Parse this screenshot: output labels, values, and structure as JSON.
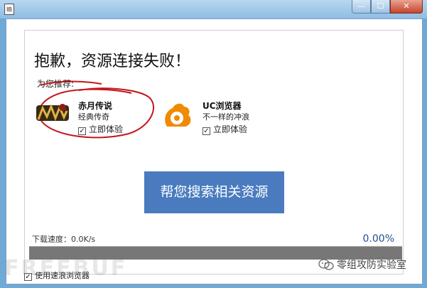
{
  "window": {
    "title": "",
    "icon_name": "app-icon",
    "controls": {
      "minimize": "—",
      "maximize": "☐",
      "close": "✕"
    }
  },
  "main": {
    "headline": "抱歉，资源连接失败！",
    "recommend_label": "为您推荐:",
    "apps": [
      {
        "name": "赤月传说",
        "description": "经典传奇",
        "check_label": "立即体验",
        "checked": true,
        "logo_icon": "legend-game-logo-icon"
      },
      {
        "name": "UC浏览器",
        "description": "不一样的冲浪",
        "check_label": "立即体验",
        "checked": true,
        "logo_icon": "uc-squirrel-logo-icon"
      }
    ],
    "search_button": "帮您搜索相关资源"
  },
  "download": {
    "speed_label": "下载速度：0.0K/s",
    "percent": "0.00%",
    "progress": 0
  },
  "footer": {
    "use_browser_label": "使用速浪浏览器",
    "use_browser_checked": true,
    "watermark_left": "FREEBUF",
    "watermark_right": "零组攻防实验室"
  },
  "colors": {
    "accent_button": "#4a7bbf",
    "progress_track": "#777777",
    "percent_text": "#1f4f8f",
    "annotation_red": "#c4161c",
    "uc_orange": "#f08a00"
  }
}
